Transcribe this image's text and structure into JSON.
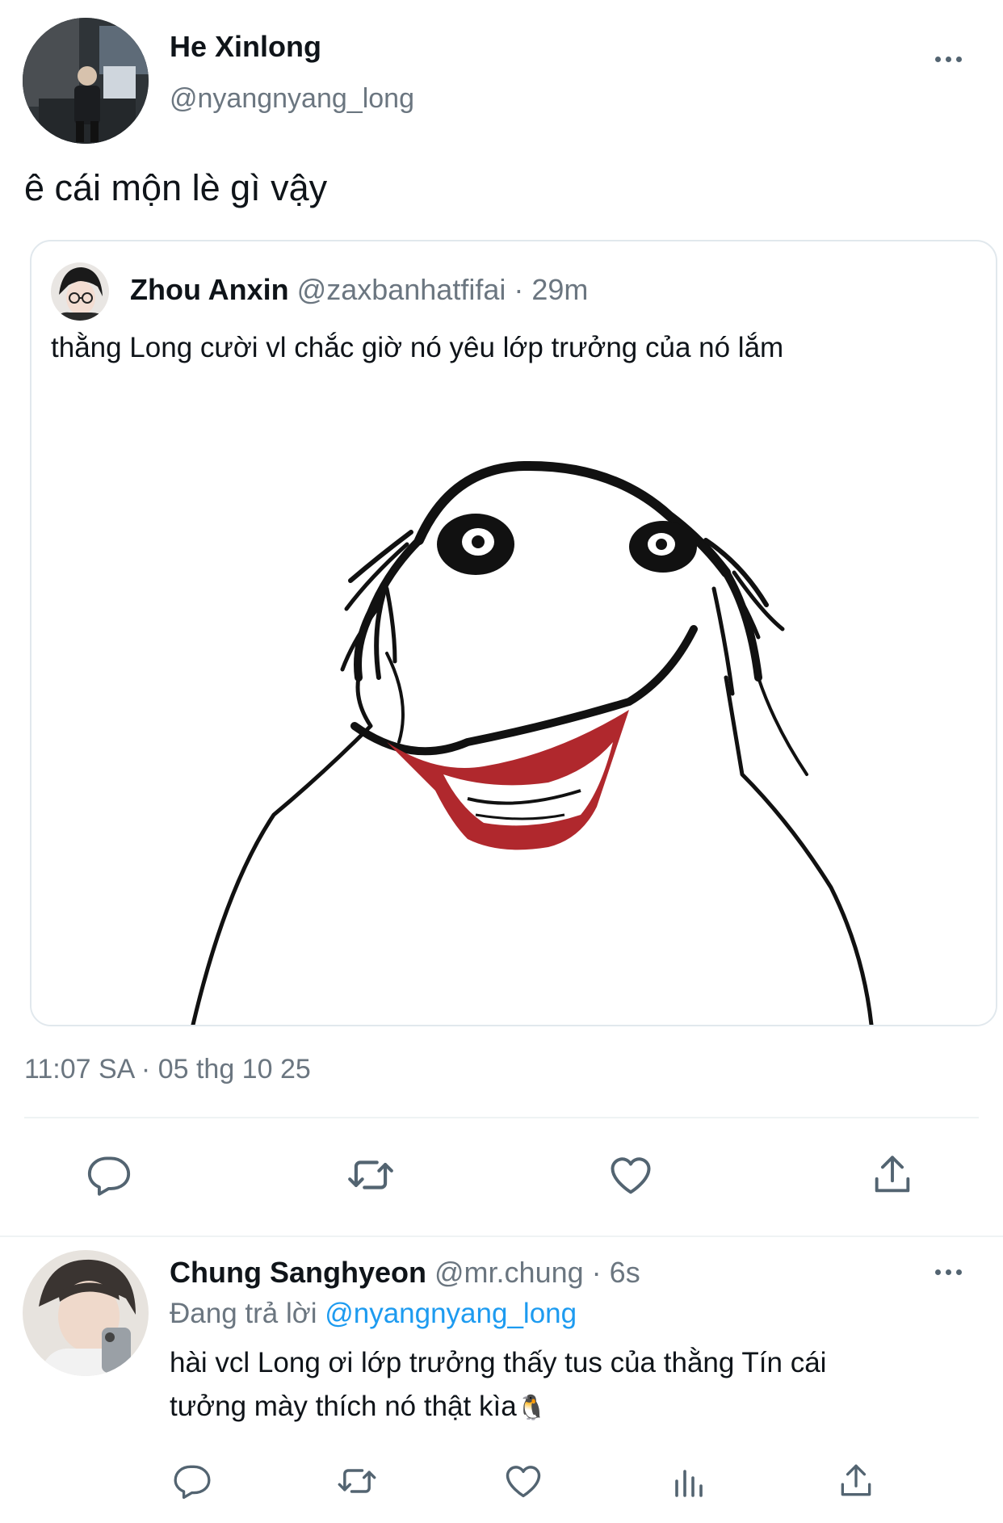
{
  "tweet": {
    "author_name": "He Xinlong",
    "author_handle": "@nyangnyang_long",
    "text": "ê cái mộn lè gì vậy",
    "timestamp": "11:07 SA · 05 thg 10 25"
  },
  "quoted_tweet": {
    "author_name": "Zhou Anxin",
    "author_handle": "@zaxbanhatfifai",
    "separator": "·",
    "time": "29m",
    "text": "thằng Long cười vl chắc giờ nó yêu lớp trưởng của nó lắm"
  },
  "actions": {
    "reply_icon": "reply-icon",
    "retweet_icon": "retweet-icon",
    "like_icon": "heart-icon",
    "share_icon": "share-icon"
  },
  "reply": {
    "author_name": "Chung Sanghyeon",
    "author_handle": "@mr.chung",
    "separator": "·",
    "time": "6s",
    "replying_to_label": "Đang trả lời",
    "replying_to_handle": "@nyangnyang_long",
    "text_line1": "hài vcl Long ơi lớp trưởng thấy tus của thằng Tín cái",
    "text_line2": "tưởng mày thích nó thật kìa",
    "emoji": "🐧"
  },
  "colors": {
    "accent": "#1d9bf0",
    "secondary_text": "#6b7680",
    "icon": "#536471",
    "meme_red": "#b0282d"
  }
}
